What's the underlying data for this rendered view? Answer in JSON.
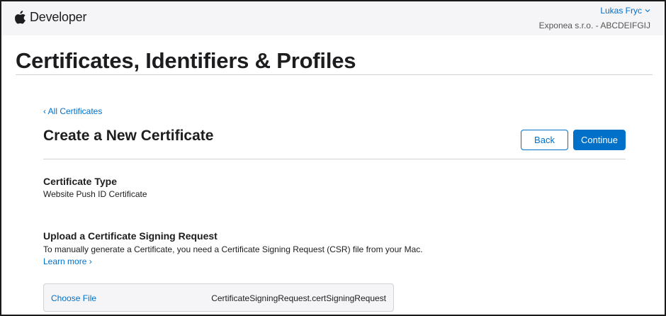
{
  "header": {
    "brand_label": "Developer",
    "user_name": "Lukas Fryc",
    "team": "Exponea s.r.o. - ABCDEIFGIJ"
  },
  "page": {
    "title": "Certificates, Identifiers & Profiles"
  },
  "content": {
    "back_link": "‹ All Certificates",
    "section_title": "Create a New Certificate",
    "back_button": "Back",
    "continue_button": "Continue",
    "certificate_type_label": "Certificate Type",
    "certificate_type_value": "Website Push ID Certificate",
    "upload_label": "Upload a Certificate Signing Request",
    "upload_description": "To manually generate a Certificate, you need a Certificate Signing Request (CSR) file from your Mac.",
    "learn_more": "Learn more ›",
    "choose_file": "Choose File",
    "selected_file": "CertificateSigningRequest.certSigningRequest"
  },
  "colors": {
    "accent": "#0070c9",
    "topbar_bg": "#f5f5f7",
    "divider": "#d2d2d7"
  },
  "icons": {
    "brand": "apple-icon",
    "account_menu": "chevron-down-icon"
  }
}
